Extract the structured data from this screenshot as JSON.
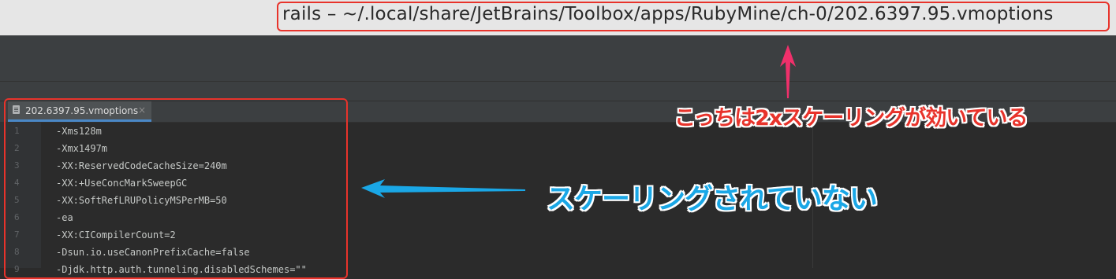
{
  "window": {
    "title": "rails – ~/.local/share/JetBrains/Toolbox/apps/RubyMine/ch-0/202.6397.95.vmoptions"
  },
  "editor_tab": {
    "label": "202.6397.95.vmoptions",
    "icon": "file-text-icon",
    "close_icon": "close-icon",
    "close_glyph": "×"
  },
  "editor": {
    "lines": [
      {
        "number": "1",
        "text": "-Xms128m"
      },
      {
        "number": "2",
        "text": "-Xmx1497m"
      },
      {
        "number": "3",
        "text": "-XX:ReservedCodeCacheSize=240m"
      },
      {
        "number": "4",
        "text": "-XX:+UseConcMarkSweepGC"
      },
      {
        "number": "5",
        "text": "-XX:SoftRefLRUPolicyMSPerMB=50"
      },
      {
        "number": "6",
        "text": "-ea"
      },
      {
        "number": "7",
        "text": "-XX:CICompilerCount=2"
      },
      {
        "number": "8",
        "text": "-Dsun.io.useCanonPrefixCache=false"
      },
      {
        "number": "9",
        "text": "-Djdk.http.auth.tunneling.disabledSchemes=\"\""
      }
    ]
  },
  "annotations": {
    "scaled_note": "こっちは2xスケーリングが効いている",
    "not_scaled_note": "スケーリングされていない",
    "colors": {
      "red": "#e8332b",
      "pink_arrow": "#f0306b",
      "blue": "#1aa7e6"
    }
  }
}
